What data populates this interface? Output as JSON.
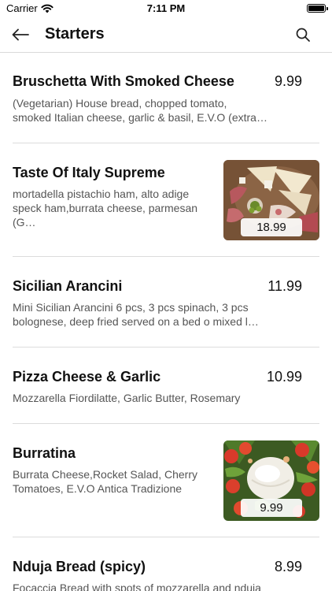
{
  "status_bar": {
    "carrier": "Carrier",
    "time": "7:11 PM"
  },
  "header": {
    "title": "Starters"
  },
  "items": [
    {
      "name": "Bruschetta With Smoked Cheese",
      "desc_line1": "(Vegetarian) House bread, chopped tomato,",
      "desc_line2": "smoked Italian cheese, garlic & basil, E.V.O (extra…",
      "price": "9.99"
    },
    {
      "name": "Taste Of Italy Supreme",
      "desc_line1": "mortadella pistachio ham, alto adige",
      "desc_line2": "speck ham,burrata cheese, parmesan (G…",
      "price": "18.99"
    },
    {
      "name": "Sicilian Arancini",
      "desc_line1": "Mini Sicilian Arancini 6 pcs, 3 pcs spinach, 3 pcs",
      "desc_line2": "bolognese, deep fried served on a bed o mixed l…",
      "price": "11.99"
    },
    {
      "name": "Pizza Cheese & Garlic",
      "desc_line1": "Mozzarella Fiordilatte, Garlic Butter, Rosemary",
      "price": "10.99"
    },
    {
      "name": "Burratina",
      "desc_line1": "Burrata Cheese,Rocket Salad, Cherry",
      "desc_line2": "Tomatoes, E.V.O Antica Tradizione",
      "price": "9.99"
    },
    {
      "name": "Nduja Bread (spicy)",
      "desc_line1": "Focaccia Bread with spots of mozzarella and nduja",
      "price": "8.99"
    }
  ]
}
